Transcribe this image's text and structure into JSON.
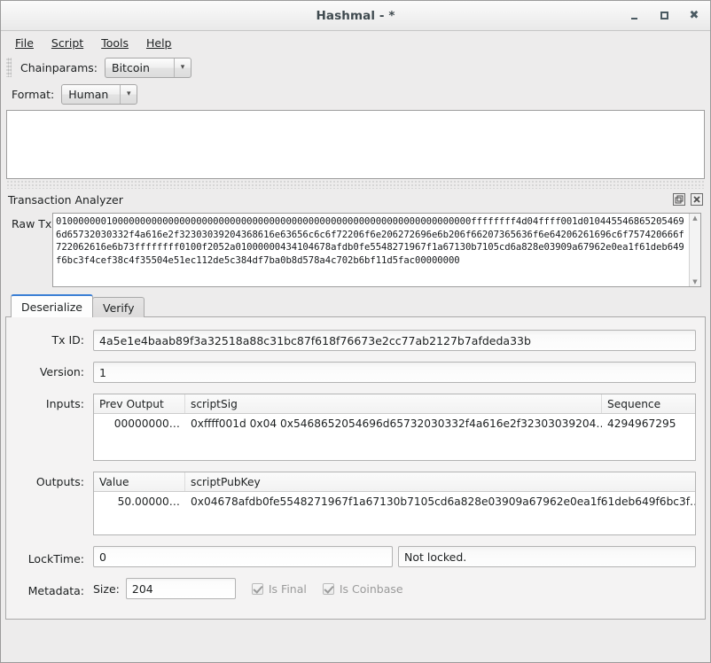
{
  "window": {
    "title": "Hashmal - *",
    "minimize_label": "_",
    "maximize_label": "□",
    "close_label": "✖"
  },
  "menubar": {
    "items": [
      {
        "label": "File"
      },
      {
        "label": "Script"
      },
      {
        "label": "Tools"
      },
      {
        "label": "Help"
      }
    ]
  },
  "toolbars": {
    "chainparams": {
      "label": "Chainparams:",
      "value": "Bitcoin",
      "arrow": "▾"
    },
    "format": {
      "label": "Format:",
      "value": "Human",
      "arrow": "▾"
    }
  },
  "editor": {
    "text": ""
  },
  "dock": {
    "title": "Transaction Analyzer",
    "float_title": "Float",
    "close_title": "Close"
  },
  "rawtx": {
    "label": "Raw Tx:",
    "value": "01000000010000000000000000000000000000000000000000000000000000000000000000ffffffff4d04ffff001d0104455468652054696d65732030332f4a616e2f32303039204368616e63656c6c6f72206f6e206272696e6b206f66207365636f6e64206261696c6f757420666f722062616e6b73ffffffff0100f2052a01000000434104678afdb0fe5548271967f1a67130b7105cd6a828e03909a67962e0ea1f61deb649f6bc3f4cef38c4f35504e51ec112de5c384df7ba0b8d578a4c702b6bf11d5fac00000000"
  },
  "tabs": {
    "items": [
      {
        "label": "Deserialize",
        "selected": true
      },
      {
        "label": "Verify",
        "selected": false
      }
    ]
  },
  "deserialize": {
    "txid": {
      "label": "Tx ID:",
      "value": "4a5e1e4baab89f3a32518a88c31bc87f618f76673e2cc77ab2127b7afdeda33b"
    },
    "version": {
      "label": "Version:",
      "value": "1"
    },
    "inputs": {
      "label": "Inputs:",
      "columns": [
        "Prev Output",
        "scriptSig",
        "Sequence"
      ],
      "rows": [
        {
          "prev_output": "00000000…",
          "script_sig": "0xffff001d 0x04 0x5468652054696d65732030332f4a616e2f32303039204…",
          "sequence": "4294967295"
        }
      ]
    },
    "outputs": {
      "label": "Outputs:",
      "columns": [
        "Value",
        "scriptPubKey"
      ],
      "rows": [
        {
          "value": "50.00000…",
          "script_pub_key": "0x04678afdb0fe5548271967f1a67130b7105cd6a828e03909a67962e0ea1f61deb649f6bc3f…"
        }
      ]
    },
    "locktime": {
      "label": "LockTime:",
      "value": "0",
      "status": "Not locked."
    },
    "metadata": {
      "label": "Metadata:",
      "size_label": "Size:",
      "size_value": "204",
      "is_final_label": "Is Final",
      "is_final_checked": true,
      "is_coinbase_label": "Is Coinbase",
      "is_coinbase_checked": true
    }
  },
  "colors": {
    "window_bg": "#edecec",
    "panel_bg": "#f4f3f3",
    "accent": "#3a7fd5",
    "text": "#1d2021",
    "disabled_text": "#9a9a9a"
  }
}
